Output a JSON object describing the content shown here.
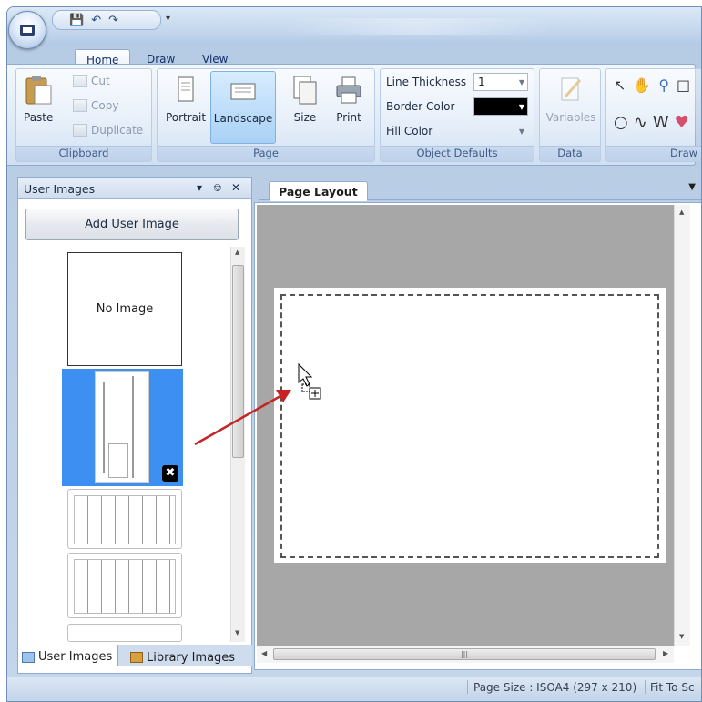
{
  "titlebar": {
    "qat_icons": [
      "save-icon",
      "undo-icon",
      "redo-icon"
    ]
  },
  "ribbon": {
    "tabs": [
      "Home",
      "Draw",
      "View"
    ],
    "clipboard": {
      "paste": "Paste",
      "cut": "Cut",
      "copy": "Copy",
      "duplicate": "Duplicate",
      "caption": "Clipboard"
    },
    "page": {
      "portrait": "Portrait",
      "landscape": "Landscape",
      "size": "Size",
      "print": "Print",
      "caption": "Page"
    },
    "object_defaults": {
      "line_thickness_label": "Line Thickness",
      "line_thickness_value": "1",
      "border_color_label": "Border Color",
      "border_color_value": "#000000",
      "fill_color_label": "Fill Color",
      "caption": "Object Defaults"
    },
    "data": {
      "variables": "Variables",
      "caption": "Data"
    },
    "draw": {
      "caption": "Draw"
    }
  },
  "side_panel": {
    "title": "User Images",
    "add_button": "Add User Image",
    "no_image": "No Image",
    "tabs": [
      "User Images",
      "Library Images"
    ]
  },
  "document": {
    "tab": "Page Layout"
  },
  "statusbar": {
    "page_size": "Page Size : ISOA4 (297 x 210)",
    "fit": "Fit To Sc"
  },
  "colors": {
    "selection": "#3d8ff2",
    "arrow": "#c62424",
    "canvas": "#a7a7a7"
  }
}
